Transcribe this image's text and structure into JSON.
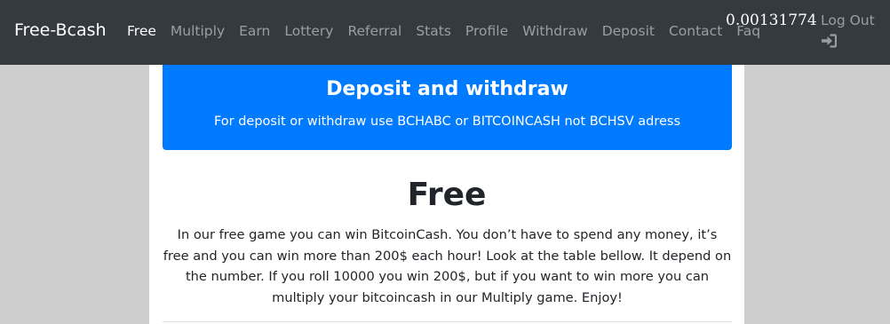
{
  "navbar": {
    "brand": "Free-Bcash",
    "links": [
      {
        "label": "Free",
        "active": true
      },
      {
        "label": "Multiply"
      },
      {
        "label": "Earn"
      },
      {
        "label": "Lottery"
      },
      {
        "label": "Referral"
      },
      {
        "label": "Stats"
      },
      {
        "label": "Profile"
      },
      {
        "label": "Withdraw"
      },
      {
        "label": "Deposit"
      },
      {
        "label": "Contact"
      },
      {
        "label": "Faq"
      }
    ],
    "balance": "0.00131774",
    "logout_label": "Log Out",
    "logout_icon": "sign-in-icon"
  },
  "alert": {
    "title": "Deposit and withdraw",
    "text": "For deposit or withdraw use BCHABC or BITCOINCASH not BCHSV adress"
  },
  "free_section": {
    "heading": "Free",
    "description": "In our free game you can win BitcoinCash. You don’t have to spend any money, it’s free and you can win more than 200$ each hour! Look at the table bellow. It depend on the number. If you roll 10000 you win 200$, but if you want to win more you can multiply your bitcoincash in our Multiply game. Enjoy!"
  },
  "colors": {
    "navbar_bg": "#343a40",
    "alert_bg": "#007bff",
    "page_bg": "#cecece"
  }
}
